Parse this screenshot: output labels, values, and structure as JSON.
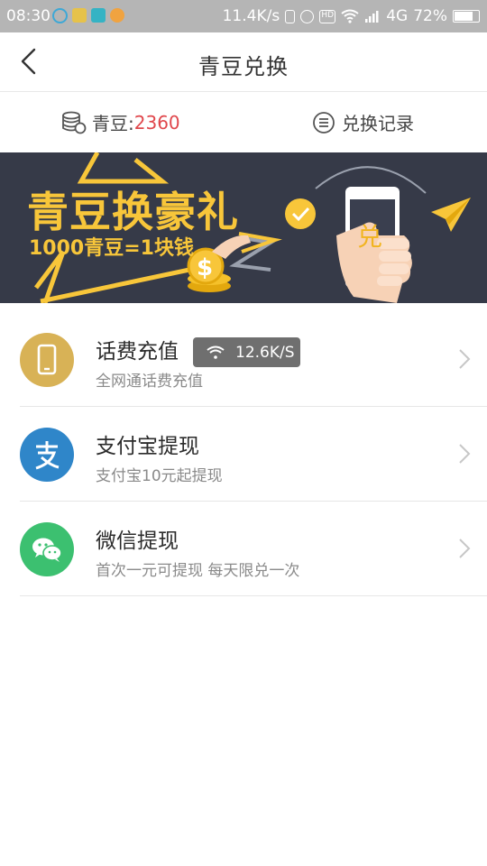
{
  "status_bar": {
    "time": "08:30",
    "net_speed": "11.4K/s",
    "network": "4G",
    "battery": "72%",
    "battery_level": 0.72
  },
  "header": {
    "title": "青豆兑换",
    "back_icon": "back-arrow-icon"
  },
  "beans": {
    "label": "青豆: ",
    "count": "2360",
    "records_label": "兑换记录"
  },
  "banner": {
    "title": "青豆换豪礼",
    "subtitle": "1000青豆=1块钱",
    "phone_char": "兑",
    "colors": {
      "bg": "#363a48",
      "accent": "#f8c63a"
    }
  },
  "items": [
    {
      "title": "话费充值",
      "subtitle": "全网通话费充值",
      "icon": "phone-icon",
      "color": "#d8b256"
    },
    {
      "title": "支付宝提现",
      "subtitle": "支付宝10元起提现",
      "icon": "alipay-icon",
      "color": "#2f86c9"
    },
    {
      "title": "微信提现",
      "subtitle": "首次一元可提现 每天限兑一次",
      "icon": "wechat-icon",
      "color": "#3cc070"
    }
  ],
  "toast": {
    "speed": "12.6K/S"
  }
}
